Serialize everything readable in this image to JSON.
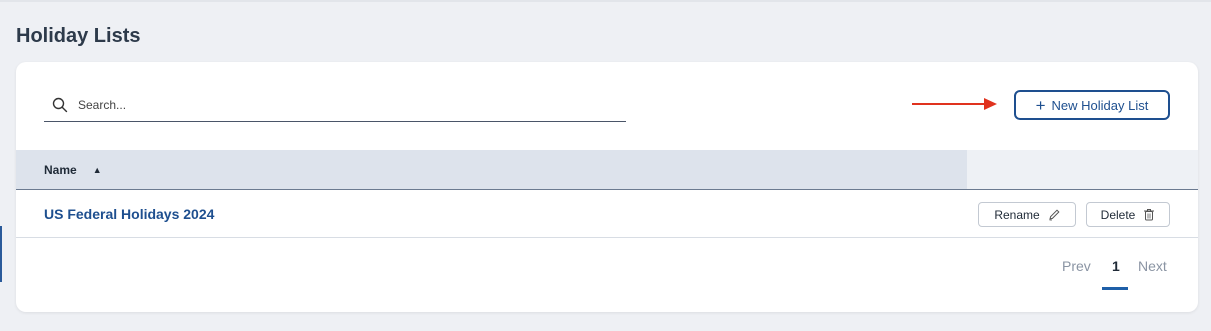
{
  "page": {
    "title": "Holiday Lists"
  },
  "search": {
    "placeholder": "Search...",
    "value": ""
  },
  "toolbar": {
    "new_button_label": "New Holiday List",
    "new_button_icon": "plus-icon"
  },
  "table": {
    "columns": [
      {
        "label": "Name",
        "sort": "ascending"
      },
      {
        "label": ""
      }
    ],
    "rows": [
      {
        "name": "US Federal Holidays 2024",
        "actions": {
          "rename_label": "Rename",
          "rename_icon": "pencil-icon",
          "delete_label": "Delete",
          "delete_icon": "trash-icon"
        }
      }
    ]
  },
  "pagination": {
    "prev_label": "Prev",
    "current_page": "1",
    "next_label": "Next"
  },
  "colors": {
    "accent": "#1e4f8f",
    "annotation_arrow": "#e0321e",
    "header_bg": "#dde3ec"
  }
}
